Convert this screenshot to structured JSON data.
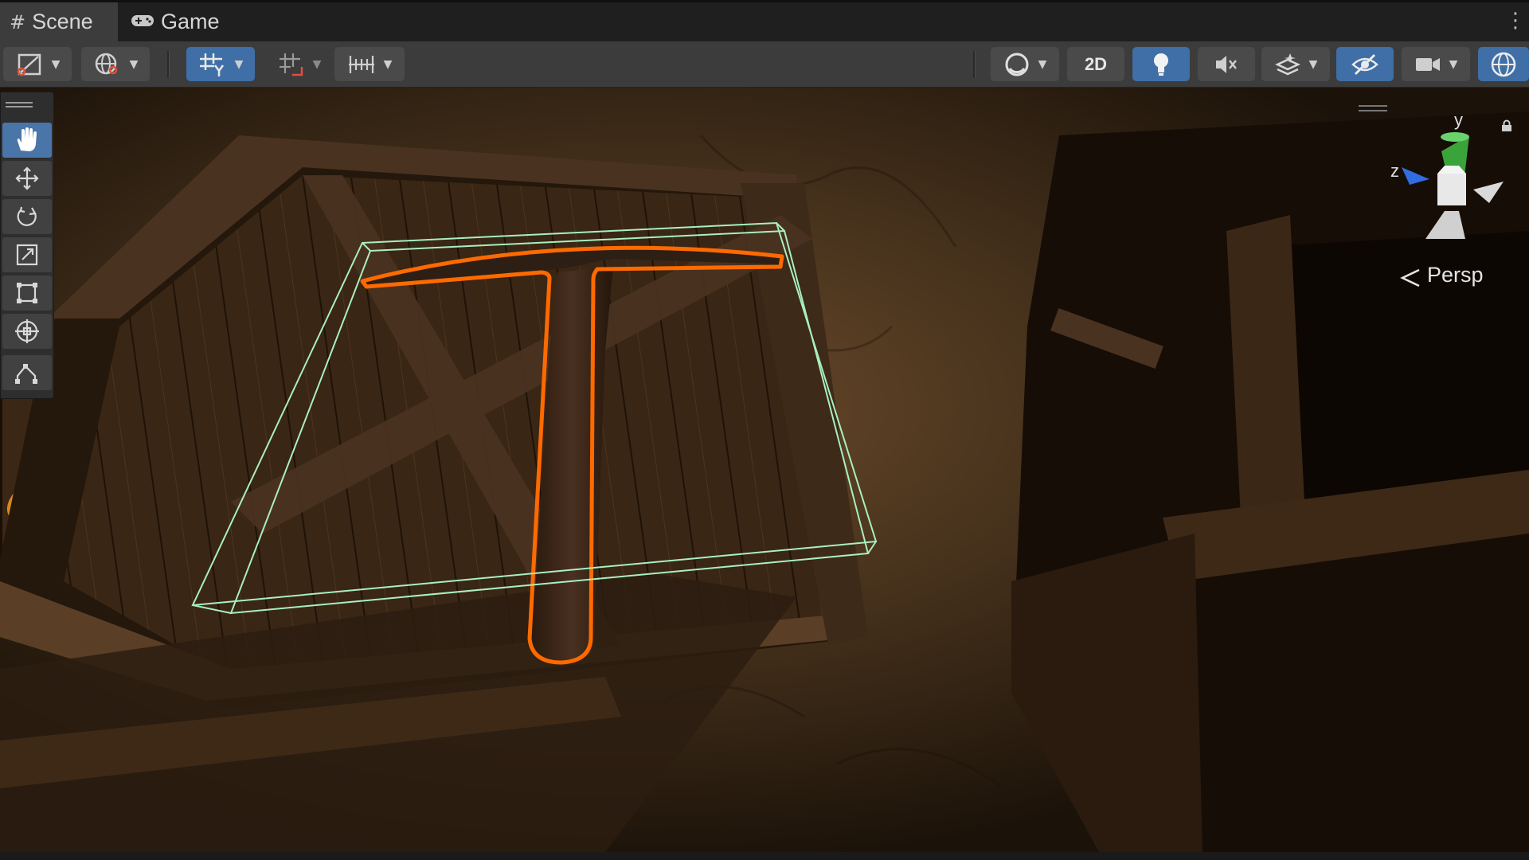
{
  "tabs": [
    {
      "label": "Scene",
      "icon": "hash-icon",
      "active": true
    },
    {
      "label": "Game",
      "icon": "gamepad-icon",
      "active": false
    }
  ],
  "toolbar": {
    "toggle_2d_label": "2D",
    "lighting_on": true,
    "hidden_objects_toggle_on": true
  },
  "gizmo": {
    "y_label": "y",
    "z_label": "z",
    "projection_label": "Persp"
  },
  "colors": {
    "accent_blue": "#3f6fa6",
    "selection_outline": "#ff6a00",
    "bounds_gizmo": "#a8f0c0"
  }
}
